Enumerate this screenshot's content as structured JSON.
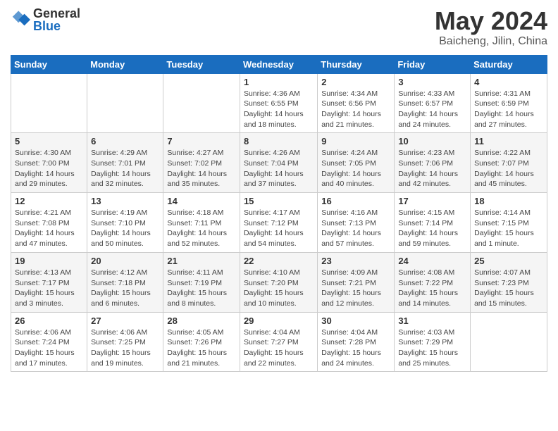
{
  "header": {
    "logo_general": "General",
    "logo_blue": "Blue",
    "title": "May 2024",
    "location": "Baicheng, Jilin, China"
  },
  "calendar": {
    "headers": [
      "Sunday",
      "Monday",
      "Tuesday",
      "Wednesday",
      "Thursday",
      "Friday",
      "Saturday"
    ],
    "weeks": [
      [
        {
          "day": "",
          "detail": ""
        },
        {
          "day": "",
          "detail": ""
        },
        {
          "day": "",
          "detail": ""
        },
        {
          "day": "1",
          "detail": "Sunrise: 4:36 AM\nSunset: 6:55 PM\nDaylight: 14 hours\nand 18 minutes."
        },
        {
          "day": "2",
          "detail": "Sunrise: 4:34 AM\nSunset: 6:56 PM\nDaylight: 14 hours\nand 21 minutes."
        },
        {
          "day": "3",
          "detail": "Sunrise: 4:33 AM\nSunset: 6:57 PM\nDaylight: 14 hours\nand 24 minutes."
        },
        {
          "day": "4",
          "detail": "Sunrise: 4:31 AM\nSunset: 6:59 PM\nDaylight: 14 hours\nand 27 minutes."
        }
      ],
      [
        {
          "day": "5",
          "detail": "Sunrise: 4:30 AM\nSunset: 7:00 PM\nDaylight: 14 hours\nand 29 minutes."
        },
        {
          "day": "6",
          "detail": "Sunrise: 4:29 AM\nSunset: 7:01 PM\nDaylight: 14 hours\nand 32 minutes."
        },
        {
          "day": "7",
          "detail": "Sunrise: 4:27 AM\nSunset: 7:02 PM\nDaylight: 14 hours\nand 35 minutes."
        },
        {
          "day": "8",
          "detail": "Sunrise: 4:26 AM\nSunset: 7:04 PM\nDaylight: 14 hours\nand 37 minutes."
        },
        {
          "day": "9",
          "detail": "Sunrise: 4:24 AM\nSunset: 7:05 PM\nDaylight: 14 hours\nand 40 minutes."
        },
        {
          "day": "10",
          "detail": "Sunrise: 4:23 AM\nSunset: 7:06 PM\nDaylight: 14 hours\nand 42 minutes."
        },
        {
          "day": "11",
          "detail": "Sunrise: 4:22 AM\nSunset: 7:07 PM\nDaylight: 14 hours\nand 45 minutes."
        }
      ],
      [
        {
          "day": "12",
          "detail": "Sunrise: 4:21 AM\nSunset: 7:08 PM\nDaylight: 14 hours\nand 47 minutes."
        },
        {
          "day": "13",
          "detail": "Sunrise: 4:19 AM\nSunset: 7:10 PM\nDaylight: 14 hours\nand 50 minutes."
        },
        {
          "day": "14",
          "detail": "Sunrise: 4:18 AM\nSunset: 7:11 PM\nDaylight: 14 hours\nand 52 minutes."
        },
        {
          "day": "15",
          "detail": "Sunrise: 4:17 AM\nSunset: 7:12 PM\nDaylight: 14 hours\nand 54 minutes."
        },
        {
          "day": "16",
          "detail": "Sunrise: 4:16 AM\nSunset: 7:13 PM\nDaylight: 14 hours\nand 57 minutes."
        },
        {
          "day": "17",
          "detail": "Sunrise: 4:15 AM\nSunset: 7:14 PM\nDaylight: 14 hours\nand 59 minutes."
        },
        {
          "day": "18",
          "detail": "Sunrise: 4:14 AM\nSunset: 7:15 PM\nDaylight: 15 hours\nand 1 minute."
        }
      ],
      [
        {
          "day": "19",
          "detail": "Sunrise: 4:13 AM\nSunset: 7:17 PM\nDaylight: 15 hours\nand 3 minutes."
        },
        {
          "day": "20",
          "detail": "Sunrise: 4:12 AM\nSunset: 7:18 PM\nDaylight: 15 hours\nand 6 minutes."
        },
        {
          "day": "21",
          "detail": "Sunrise: 4:11 AM\nSunset: 7:19 PM\nDaylight: 15 hours\nand 8 minutes."
        },
        {
          "day": "22",
          "detail": "Sunrise: 4:10 AM\nSunset: 7:20 PM\nDaylight: 15 hours\nand 10 minutes."
        },
        {
          "day": "23",
          "detail": "Sunrise: 4:09 AM\nSunset: 7:21 PM\nDaylight: 15 hours\nand 12 minutes."
        },
        {
          "day": "24",
          "detail": "Sunrise: 4:08 AM\nSunset: 7:22 PM\nDaylight: 15 hours\nand 14 minutes."
        },
        {
          "day": "25",
          "detail": "Sunrise: 4:07 AM\nSunset: 7:23 PM\nDaylight: 15 hours\nand 15 minutes."
        }
      ],
      [
        {
          "day": "26",
          "detail": "Sunrise: 4:06 AM\nSunset: 7:24 PM\nDaylight: 15 hours\nand 17 minutes."
        },
        {
          "day": "27",
          "detail": "Sunrise: 4:06 AM\nSunset: 7:25 PM\nDaylight: 15 hours\nand 19 minutes."
        },
        {
          "day": "28",
          "detail": "Sunrise: 4:05 AM\nSunset: 7:26 PM\nDaylight: 15 hours\nand 21 minutes."
        },
        {
          "day": "29",
          "detail": "Sunrise: 4:04 AM\nSunset: 7:27 PM\nDaylight: 15 hours\nand 22 minutes."
        },
        {
          "day": "30",
          "detail": "Sunrise: 4:04 AM\nSunset: 7:28 PM\nDaylight: 15 hours\nand 24 minutes."
        },
        {
          "day": "31",
          "detail": "Sunrise: 4:03 AM\nSunset: 7:29 PM\nDaylight: 15 hours\nand 25 minutes."
        },
        {
          "day": "",
          "detail": ""
        }
      ]
    ]
  }
}
